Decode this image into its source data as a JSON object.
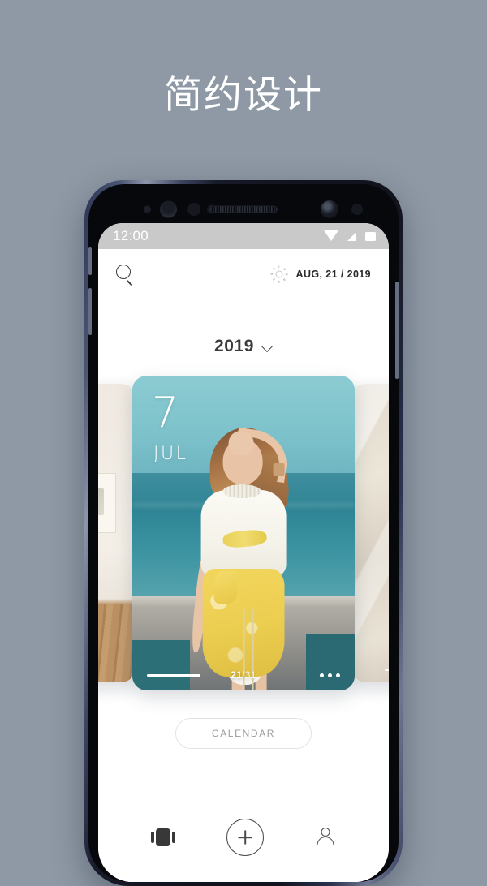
{
  "headline": "简约设计",
  "phone": {
    "statusbar": {
      "time": "12:00",
      "icons": [
        "wifi-icon",
        "signal-icon",
        "battery-icon"
      ]
    },
    "appbar": {
      "search_icon": "search-icon",
      "weather_icon": "sun-icon",
      "date": "AUG, 21 / 2019"
    },
    "year_selector": {
      "year": "2019",
      "chevron": "chevron-down-icon"
    },
    "carousel": {
      "cards": [
        {
          "position": "left",
          "photo": "interior-room-wooden-floor",
          "day": "",
          "month": ""
        },
        {
          "position": "center",
          "photo": "woman-yellow-skirt-beach",
          "day": "7",
          "month": "JUL",
          "counter_current": "21",
          "counter_separator": "/",
          "counter_total": "31",
          "more_icon": "more-dots-icon"
        },
        {
          "position": "right",
          "photo": "cream-fabric-texture",
          "day": "",
          "month": ""
        }
      ]
    },
    "calendar_button": "CALENDAR",
    "bottom_nav": [
      {
        "name": "cards-view",
        "icon": "carousel-icon"
      },
      {
        "name": "add",
        "icon": "plus-circle-icon"
      },
      {
        "name": "profile",
        "icon": "person-icon"
      }
    ]
  },
  "colors": {
    "background": "#8f99a5",
    "statusbar": "#c9c9c9",
    "accent_teal": "#3f8e9e",
    "accent_yellow": "#f2d65c",
    "text_dark": "#2b2b2b",
    "text_muted": "#9c9c9c"
  }
}
